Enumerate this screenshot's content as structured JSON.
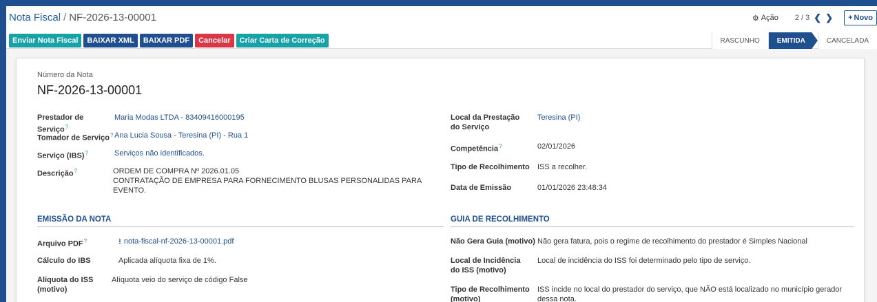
{
  "breadcrumb": {
    "parent": "Nota Fiscal",
    "separator": "/",
    "current": "NF-2026-13-00001"
  },
  "actions": {
    "acao_label": "Ação",
    "pager": "2 / 3",
    "novo_label": "Novo"
  },
  "buttons": {
    "enviar": "Enviar Nota Fiscal",
    "xml": "BAIXAR XML",
    "pdf": "BAIXAR PDF",
    "cancelar": "Cancelar",
    "carta": "Criar Carta de Correção"
  },
  "statusbar": {
    "rascunho": "RASCUNHO",
    "emitida": "EMITIDA",
    "cancelada": "CANCELADA"
  },
  "form": {
    "numero_label": "Número da Nota",
    "numero_value": "NF-2026-13-00001",
    "left": {
      "prestador_label": "Prestador de Serviço",
      "prestador_value": "Maria Modas LTDA - 83409416000195",
      "tomador_label": "Tomador de Serviço",
      "tomador_value": "Ana Lucia Sousa - Teresina (PI) - Rua 1",
      "servico_label": "Serviço (IBS)",
      "servico_value": "Serviços não identificados.",
      "descricao_label": "Descrição",
      "descricao_line1": "ORDEM DE COMPRA Nº 2026.01.05",
      "descricao_line2": "CONTRATAÇÃO DE EMPRESA PARA FORNECIMENTO BLUSAS PERSONALIDAS PARA EVENTO."
    },
    "right": {
      "local_label": "Local da Prestação do Serviço",
      "local_value": "Teresina (PI)",
      "competencia_label": "Competência",
      "competencia_value": "02/01/2026",
      "tipo_label": "Tipo de Recolhimento",
      "tipo_value": "ISS a recolher.",
      "data_label": "Data de Emissão",
      "data_value": "01/01/2026 23:48:34"
    },
    "emissao": {
      "title": "EMISSÃO DA NOTA",
      "arquivo_label": "Arquivo PDF",
      "arquivo_value": "nota-fiscal-nf-2026-13-00001.pdf",
      "calculo_label": "Cálculo do IBS",
      "calculo_value": "Aplicada alíquota fixa de 1%.",
      "aliquota_label": "Alíquota do ISS (motivo)",
      "aliquota_value": "Alíquota veio do serviço de código False"
    },
    "guia": {
      "title": "GUIA DE RECOLHIMENTO",
      "nao_gera_label": "Não Gera Guia (motivo)",
      "nao_gera_value": "Não gera fatura, pois o regime de recolhimento do prestador é Simples Nacional",
      "local_inc_label": "Local de Incidência do ISS (motivo)",
      "local_inc_value": "Local de incidência do ISS foi determinado pelo tipo de serviço.",
      "tipo_rec_label": "Tipo de Recolhimento (motivo)",
      "tipo_rec_value": "ISS incide no local do prestador do serviço, que NÃO está localizado no município gerador dessa nota."
    },
    "help_mark": "?"
  },
  "colors": {
    "primary": "#1f4f8f",
    "teal": "#17a2a8",
    "danger": "#dc3545",
    "help": "#1f8fd8"
  },
  "icons": {
    "gear": "gear-icon",
    "download": "download-icon",
    "prev": "chevron-left-icon",
    "next": "chevron-right-icon",
    "plus": "plus-icon"
  }
}
